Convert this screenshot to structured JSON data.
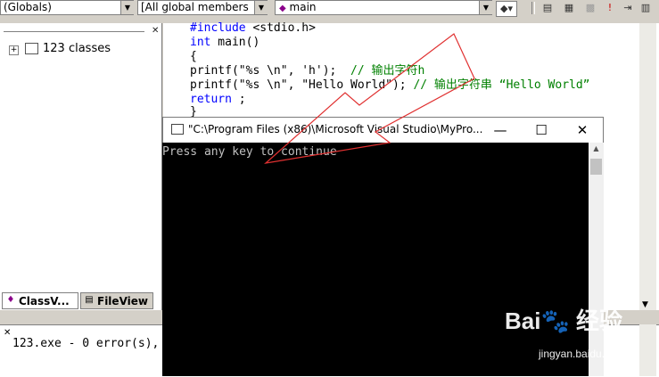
{
  "toolbar": {
    "scope_combo": "(Globals)",
    "members_combo": "[All global members",
    "function_combo": "main",
    "dropdown_glyph": "▼"
  },
  "classview": {
    "root_label": "123 classes",
    "tabs": [
      {
        "label": "ClassV..."
      },
      {
        "label": "FileView"
      }
    ]
  },
  "editor": {
    "lines": [
      {
        "kw": "#include",
        "text": " <stdio.h>",
        "comment": ""
      },
      {
        "kw": "int",
        "text": " main()",
        "comment": ""
      },
      {
        "kw": "",
        "text": "{",
        "comment": ""
      },
      {
        "kw": "",
        "text": "printf(\"%s \\n\", 'h');  ",
        "comment": "// 输出字符h"
      },
      {
        "kw": "",
        "text": "printf(\"%s \\n\", \"Hello World\"); ",
        "comment": "// 输出字符串 “Hello World”"
      },
      {
        "kw": "return",
        "text": " ;",
        "comment": ""
      },
      {
        "kw": "",
        "text": "}",
        "comment": ""
      }
    ]
  },
  "output": {
    "text": "123.exe - 0 error(s),"
  },
  "console": {
    "title": "\"C:\\Program Files (x86)\\Microsoft Visual Studio\\MyPro...",
    "text": "Press any key to continue",
    "buttons": {
      "minimize": "—",
      "maximize": "☐",
      "close": "✕"
    }
  },
  "watermark": {
    "logo": "Bai🐾 经验",
    "url": "jingyan.baidu.com"
  },
  "colors": {
    "keyword": "#0000ff",
    "comment": "#008000",
    "annotation_arrow": "#e03030"
  }
}
